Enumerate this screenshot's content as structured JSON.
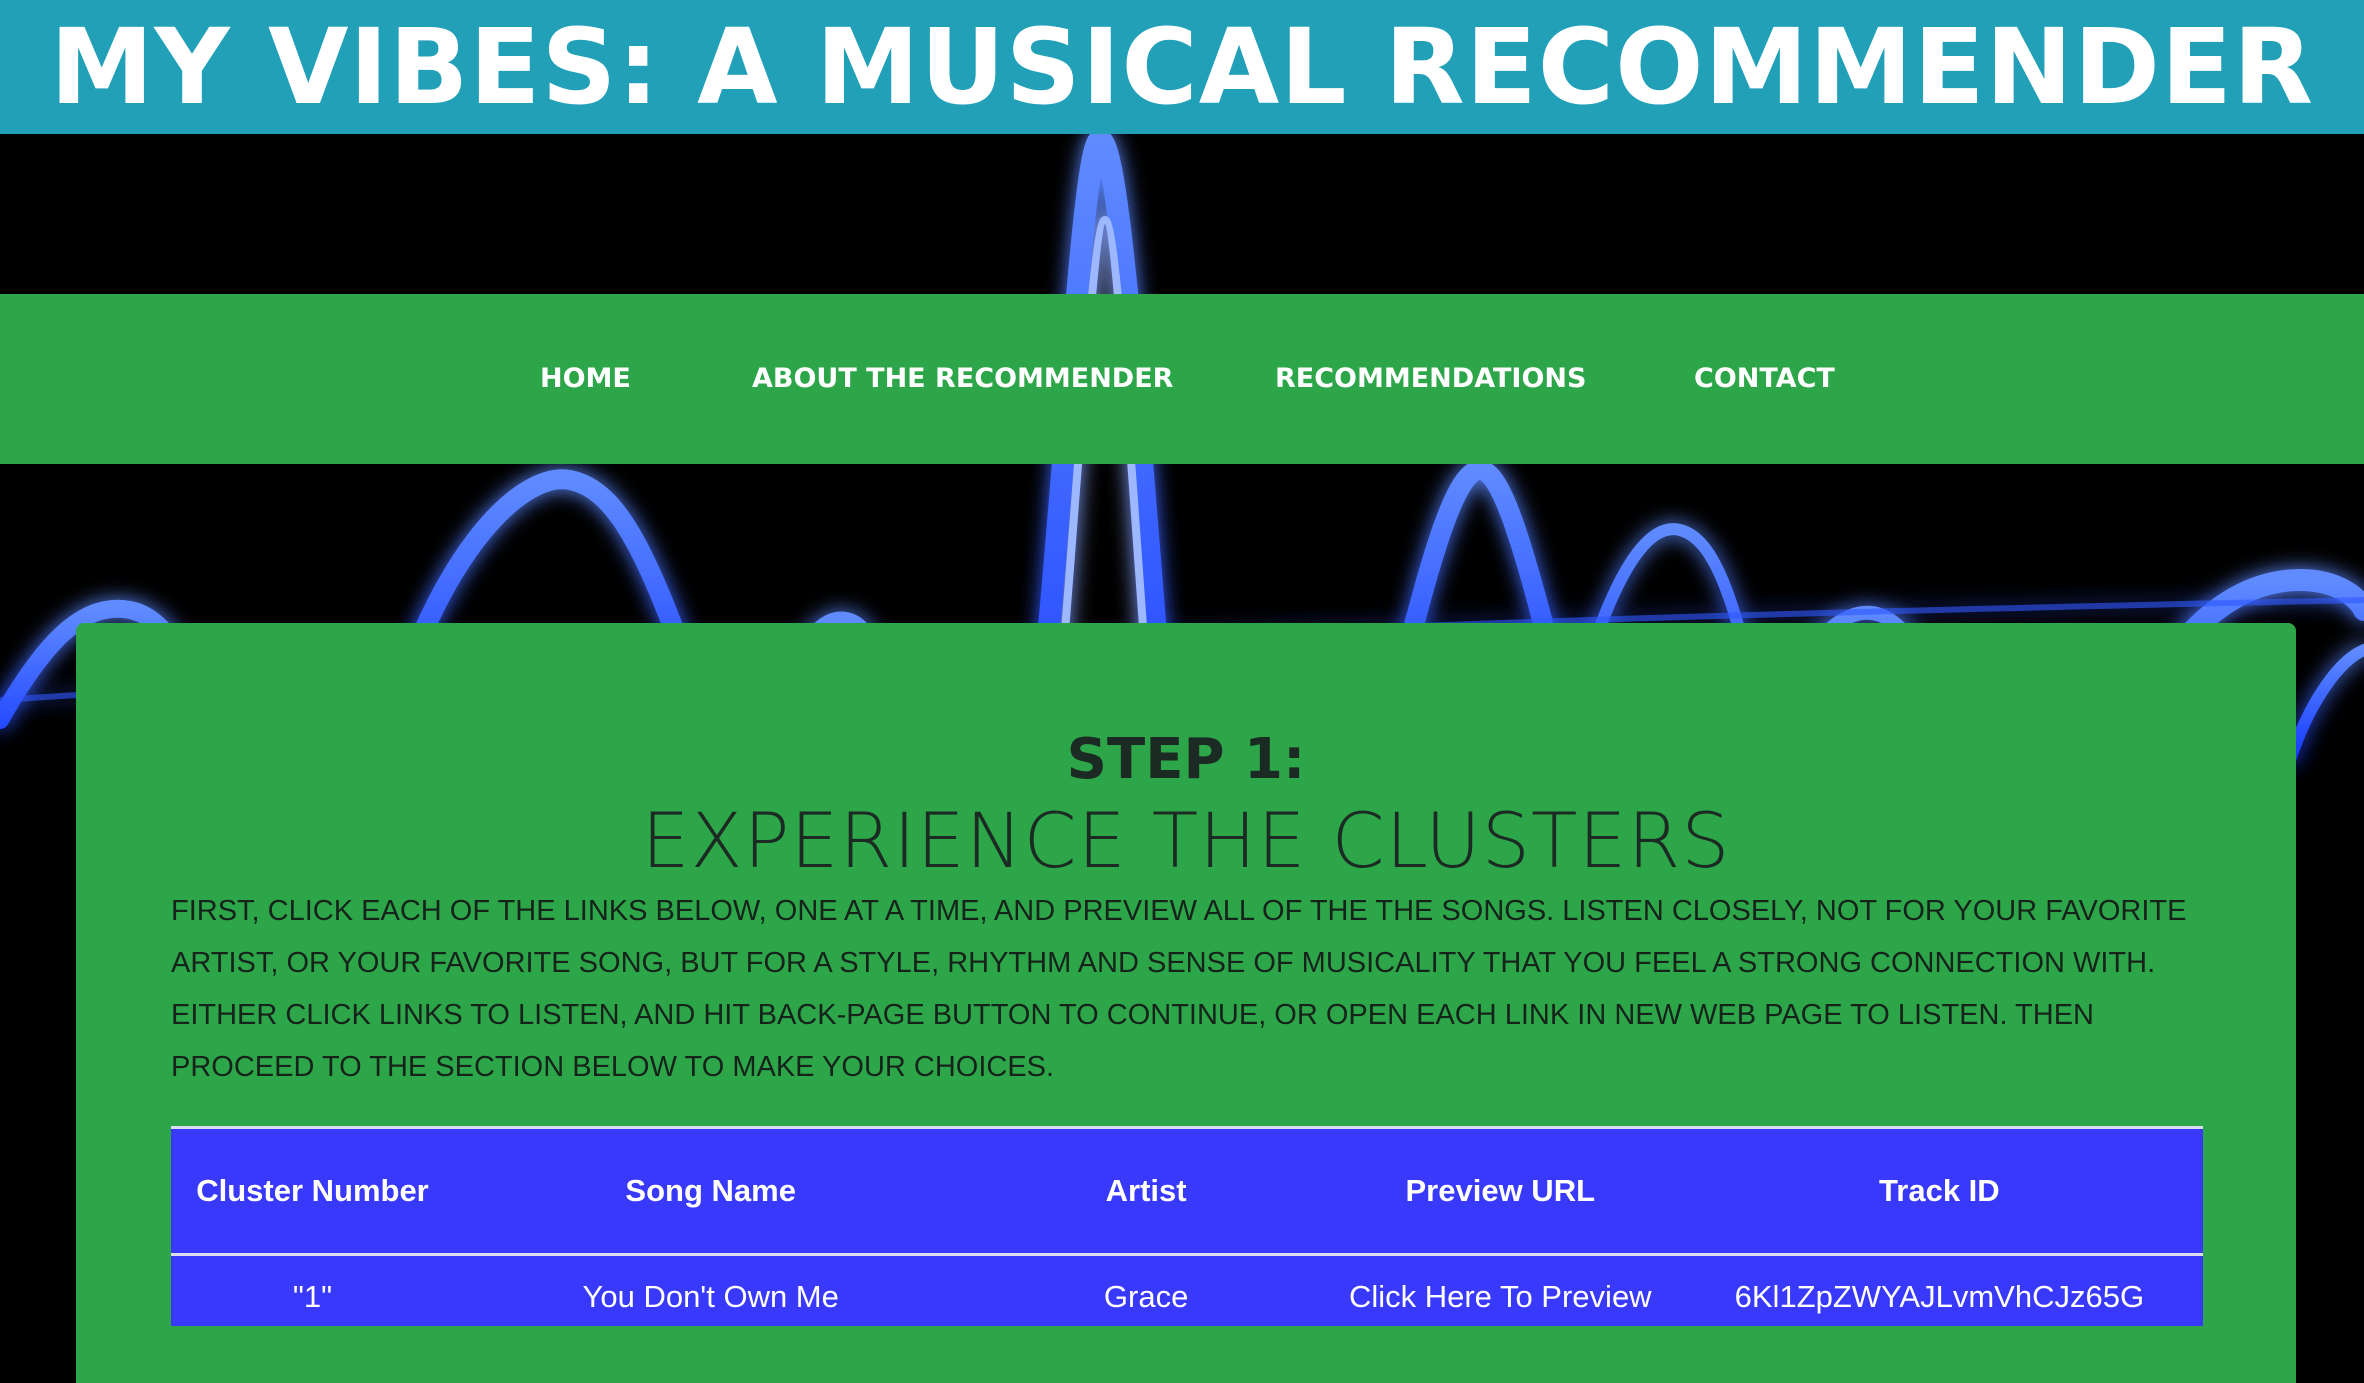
{
  "colors": {
    "title_bar": "#21a0b8",
    "green": "#2da64a",
    "table": "#3939fb",
    "wave_blue": "#1f5bff"
  },
  "header": {
    "title": "MY VIBES: A MUSICAL RECOMMENDER"
  },
  "nav": {
    "items": [
      {
        "label": "HOME"
      },
      {
        "label": "ABOUT THE RECOMMENDER"
      },
      {
        "label": "RECOMMENDATIONS"
      },
      {
        "label": "CONTACT"
      }
    ]
  },
  "step": {
    "heading": "STEP 1:",
    "subheading": "EXPERIENCE THE CLUSTERS",
    "instructions": "FIRST, CLICK EACH OF THE LINKS BELOW, ONE AT A TIME, AND PREVIEW ALL OF THE THE SONGS. LISTEN CLOSELY, NOT FOR YOUR FAVORITE ARTIST, OR YOUR FAVORITE SONG, BUT FOR A STYLE, RHYTHM AND SENSE OF MUSICALITY THAT YOU FEEL A STRONG CONNECTION WITH. EITHER CLICK LINKS TO LISTEN, AND HIT BACK-PAGE BUTTON TO CONTINUE, OR OPEN EACH LINK IN NEW WEB PAGE TO LISTEN. THEN PROCEED TO THE SECTION BELOW TO MAKE YOUR CHOICES."
  },
  "table": {
    "headers": {
      "cluster": "Cluster Number",
      "song": "Song Name",
      "artist": "Artist",
      "preview": "Preview URL",
      "track": "Track ID"
    },
    "rows": [
      {
        "cluster": "\"1\"",
        "song": "You Don't Own Me",
        "artist": "Grace",
        "preview": "Click Here To Preview",
        "track": "6Kl1ZpZWYAJLvmVhCJz65G"
      }
    ]
  }
}
